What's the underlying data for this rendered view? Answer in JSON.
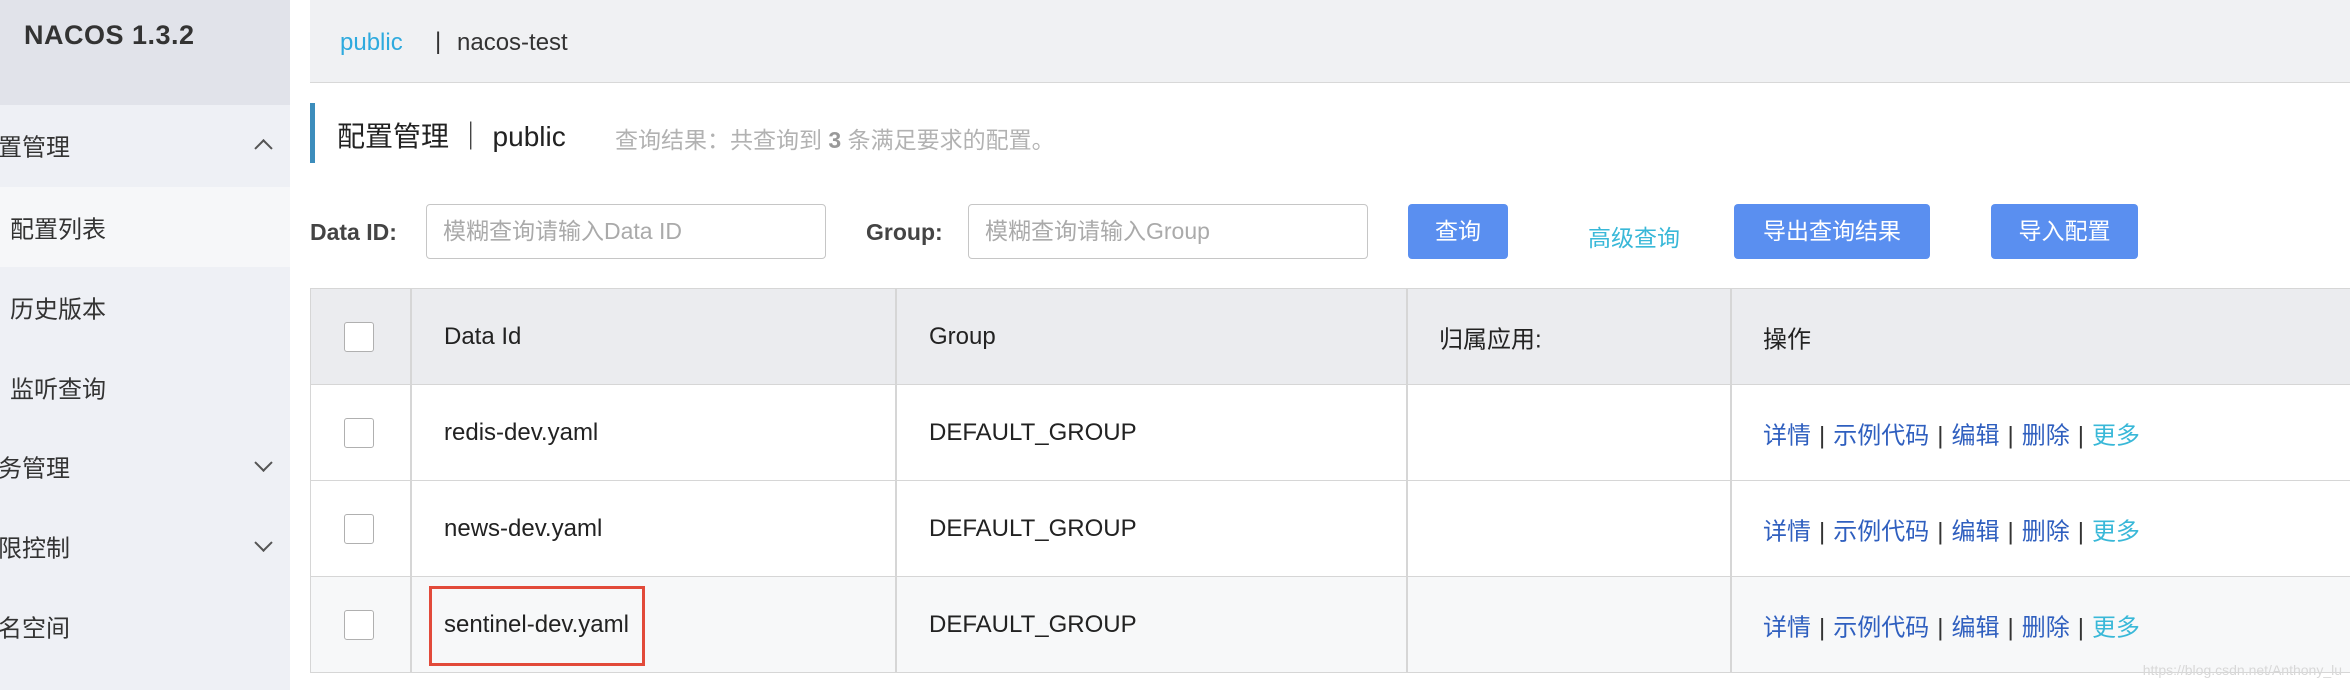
{
  "app": {
    "title": "NACOS 1.3.2"
  },
  "sidebar": {
    "items": [
      {
        "label": "置管理",
        "state": "expanded"
      },
      {
        "label": "配置列表",
        "state": "active"
      },
      {
        "label": "历史版本"
      },
      {
        "label": "监听查询"
      },
      {
        "label": "务管理",
        "state": "collapsed"
      },
      {
        "label": "限控制",
        "state": "collapsed"
      },
      {
        "label": "名空间"
      }
    ]
  },
  "namespaces": {
    "active": "public",
    "separator": "|",
    "other": "nacos-test"
  },
  "page": {
    "title": "配置管理 ｜ public",
    "query_result_prefix": "查询结果：共查询到",
    "query_result_count": "3",
    "query_result_suffix": "条满足要求的配置。"
  },
  "filters": {
    "dataid_label": "Data ID:",
    "dataid_placeholder": "模糊查询请输入Data ID",
    "group_label": "Group:",
    "group_placeholder": "模糊查询请输入Group",
    "search_button": "查询",
    "advanced_link": "高级查询",
    "export_button": "导出查询结果",
    "import_button": "导入配置"
  },
  "table": {
    "columns": [
      "Data Id",
      "Group",
      "归属应用:",
      "操作"
    ],
    "rows": [
      {
        "data_id": "redis-dev.yaml",
        "group": "DEFAULT_GROUP",
        "app": ""
      },
      {
        "data_id": "news-dev.yaml",
        "group": "DEFAULT_GROUP",
        "app": ""
      },
      {
        "data_id": "sentinel-dev.yaml",
        "group": "DEFAULT_GROUP",
        "app": "",
        "highlighted": true
      }
    ],
    "actions": [
      "详情",
      "示例代码",
      "编辑",
      "删除",
      "更多"
    ],
    "action_separator": "|"
  },
  "watermark": "https://blog.csdn.net/Anthony_lu",
  "colors": {
    "accent": "#5a8ff0",
    "link": "#2f5fbf",
    "link_light": "#39b8d8",
    "highlight": "#e24a3a"
  }
}
